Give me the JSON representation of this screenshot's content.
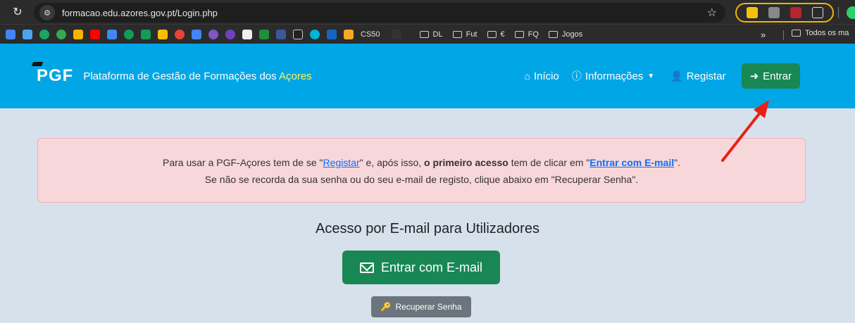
{
  "browser": {
    "url": "formacao.edu.azores.gov.pt/Login.php",
    "bookmarks": {
      "cs50": "CS50",
      "folders": [
        "DL",
        "Fut",
        "€",
        "FQ",
        "Jogos"
      ],
      "overflow": "»",
      "all_bookmarks": "Todos os ma"
    }
  },
  "navbar": {
    "logo": "PGF",
    "title_prefix": "Plataforma de Gestão de Formações dos ",
    "title_accent": "Açores",
    "links": {
      "inicio": "Início",
      "informacoes": "Informações",
      "registar": "Registar",
      "entrar": "Entrar"
    }
  },
  "alert": {
    "line1_a": "Para usar a PGF-Açores tem de se \"",
    "line1_link": "Registar",
    "line1_b": "\" e, após isso, ",
    "line1_bold": "o primeiro acesso",
    "line1_c": " tem de clicar em \"",
    "line1_link2": "Entrar com E-mail",
    "line1_d": "\".",
    "line2": "Se não se recorda da sua senha ou do seu e-mail de registo, clique abaixo em \"Recuperar Senha\"."
  },
  "main": {
    "section_title": "Acesso por E-mail para Utilizadores",
    "email_button": "Entrar com E-mail",
    "recover_button": "Recuperar Senha"
  },
  "colors": {
    "navbar": "#00a6e6",
    "accent_yellow": "#fff35c",
    "green": "#198754",
    "alert_bg": "#f8d7da",
    "arrow": "#e8201a"
  }
}
